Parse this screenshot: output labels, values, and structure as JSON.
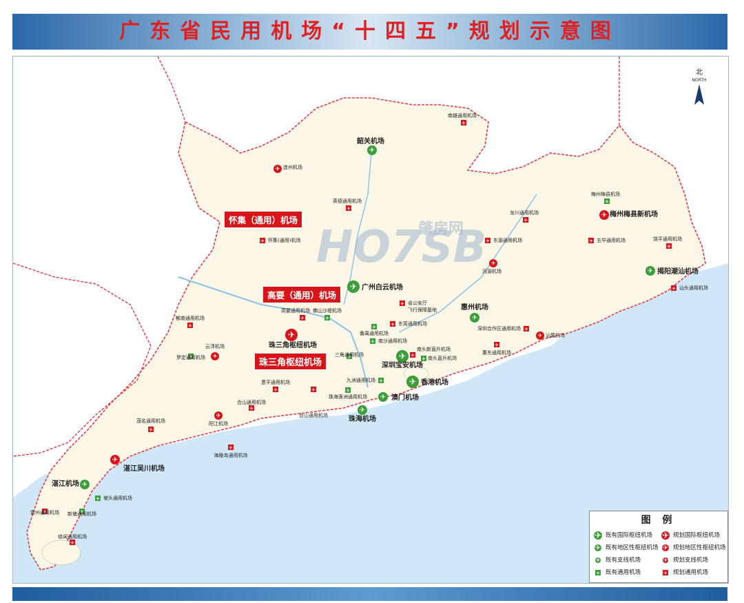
{
  "title": "广东省民用机场“十四五”规划示意图",
  "north": {
    "label_cn": "北",
    "label_en": "NORTH"
  },
  "watermark": {
    "brand": "HO7SB",
    "cn": "肇房网",
    "suffix": ".net"
  },
  "colors": {
    "existing": "#3a9d3a",
    "planned": "#d8141b",
    "land": "#fbf6e6",
    "sea": "#cfe7f6",
    "border": "#e03a4a"
  },
  "callouts": {
    "huaiji": "怀集（通用）机场",
    "gaoyao": "高要（通用）机场",
    "prd_hub": "珠三角枢纽机场"
  },
  "airports": {
    "lianzhou": "连州机场",
    "shaoguan": "韶关机场",
    "nanxiong": "南雄通用机场",
    "yingde": "英德通用机场",
    "huaiji": "怀集(通用)机场",
    "longchuan": "龙川通用机场",
    "meizhou": "梅州梅县机场",
    "meizhou_new": "梅州梅县新机场",
    "wuhua": "五华通用机场",
    "dongyuan": "东源通用机场",
    "heyuan": "河源机场",
    "raoping": "饶平通用机场",
    "jieyang": "揭阳潮汕机场",
    "shantou": "汕头通用机场",
    "baiyun": "广州白云机场",
    "gaoyao": "高要通用机场",
    "foshan": "佛山沙堤机场",
    "prd_hub": "珠三角枢纽机场",
    "provincial": "省公安厅",
    "provincial2": "飞行保障基地",
    "dongguan": "东莞通用机场",
    "panyu": "番禺通用机场",
    "huizhou": "惠州机场",
    "shenzhen_shanwei": "深圳合作区通用机场",
    "shanwei": "汕尾机场",
    "huidong": "惠东通用机场",
    "nantou_heli": "南头新直升机场",
    "nantou": "南头直升机场",
    "nansha": "南沙通用机场",
    "sanjiaozhou": "三角通用机场",
    "shenzhen": "深圳宝安机场",
    "hongkong": "香港机场",
    "jiuzhou": "九洲通用机场",
    "zhuhai_lianzhou": "珠海莲洲通用机场",
    "macau": "澳门机场",
    "zhuhai": "珠海机场",
    "enping": "恩平通用机场",
    "taishan": "台山通用机场",
    "heshan": "合山通用机场",
    "yunfu": "云浮机场",
    "luoding": "罗定通用机场",
    "yunan": "郁南通用机场",
    "maoming": "茂名通用机场",
    "yangjiang": "阳江机场",
    "hailingdao": "海陵岛通用机场",
    "zhanjiang_wuchuan": "湛江吴川机场",
    "zhanjiang": "湛江机场",
    "potou": "坡头通用机场",
    "xintang": "新塘通用机场",
    "leizhou": "雷州通用机场",
    "xuwen": "徐闻通用机场"
  },
  "legend": {
    "title": "图 例",
    "items": [
      {
        "label": "既有国际枢纽机场",
        "status": "existing",
        "kind": "intl"
      },
      {
        "label": "规划国际枢纽机场",
        "status": "planned",
        "kind": "intl"
      },
      {
        "label": "既有地区性枢纽机场",
        "status": "existing",
        "kind": "regional"
      },
      {
        "label": "规划地区性枢纽机场",
        "status": "planned",
        "kind": "regional"
      },
      {
        "label": "既有支线机场",
        "status": "existing",
        "kind": "feeder"
      },
      {
        "label": "规划支线机场",
        "status": "planned",
        "kind": "feeder"
      },
      {
        "label": "既有通用机场",
        "status": "existing",
        "kind": "general"
      },
      {
        "label": "规划通用机场",
        "status": "planned",
        "kind": "general"
      }
    ]
  }
}
